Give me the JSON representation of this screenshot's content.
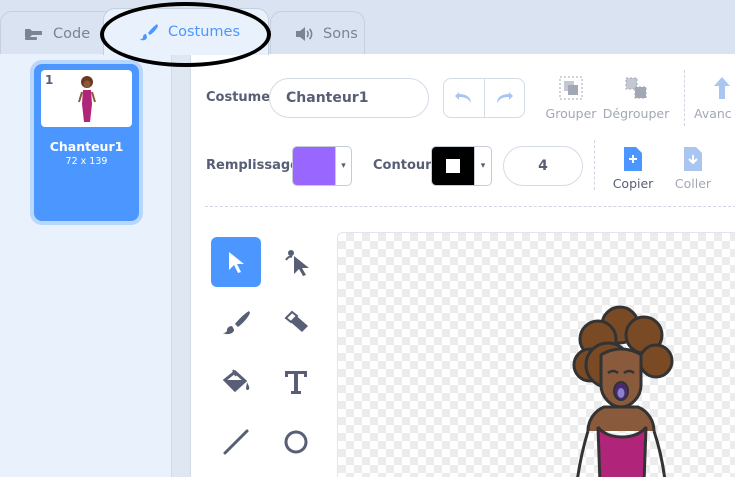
{
  "tabs": {
    "code": {
      "label": "Code",
      "icon": "code-blocks-icon"
    },
    "costumes": {
      "label": "Costumes",
      "icon": "paintbrush-icon"
    },
    "sounds": {
      "label": "Sons",
      "icon": "speaker-icon"
    }
  },
  "costume_list": [
    {
      "number": "1",
      "name": "Chanteur1",
      "size": "72 x 139",
      "selected": true
    }
  ],
  "editor": {
    "costume_label": "Costume",
    "costume_name": "Chanteur1",
    "toolbar": {
      "group": "Grouper",
      "ungroup": "Dégrouper",
      "forward": "Avanc",
      "copy": "Copier",
      "paste": "Coller"
    },
    "fill_label": "Remplissage",
    "fill_color": "#9966ff",
    "outline_label": "Contour",
    "outline_color": "#000000",
    "outline_width": "4",
    "tools": [
      "select-arrow-icon",
      "reshape-icon",
      "brush-icon",
      "eraser-icon",
      "fill-bucket-icon",
      "text-icon",
      "line-icon",
      "circle-icon"
    ]
  },
  "colors": {
    "accent": "#4c97ff",
    "text": "#575e75",
    "disabled": "#a2a7b5"
  }
}
